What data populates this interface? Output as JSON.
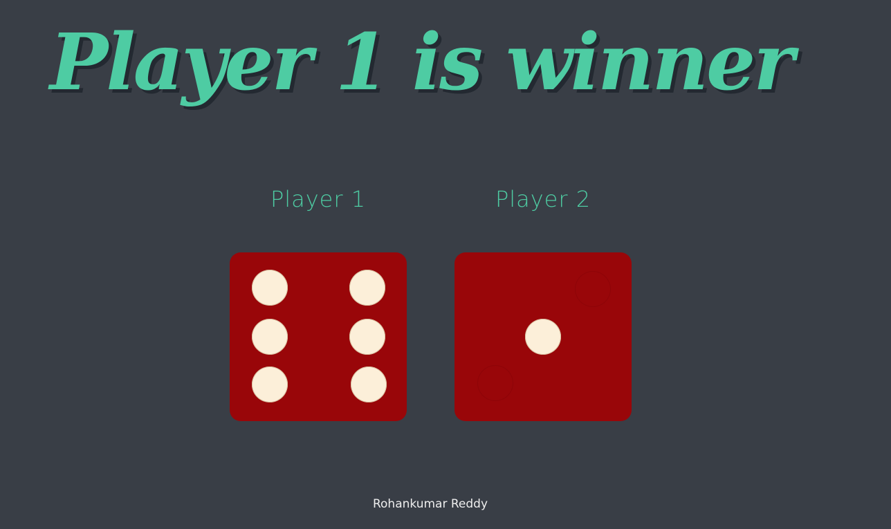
{
  "game": {
    "result_title": "Player 1 is winner",
    "players": [
      {
        "label": "Player 1",
        "die_value": 6
      },
      {
        "label": "Player 2",
        "die_value": 1
      }
    ],
    "credit": "Rohankumar Reddy"
  },
  "colors": {
    "background": "#393e46",
    "accent": "#4ecca3",
    "die": "#990609",
    "pip": "#fcefd9",
    "credit_text": "#eeeeee"
  }
}
